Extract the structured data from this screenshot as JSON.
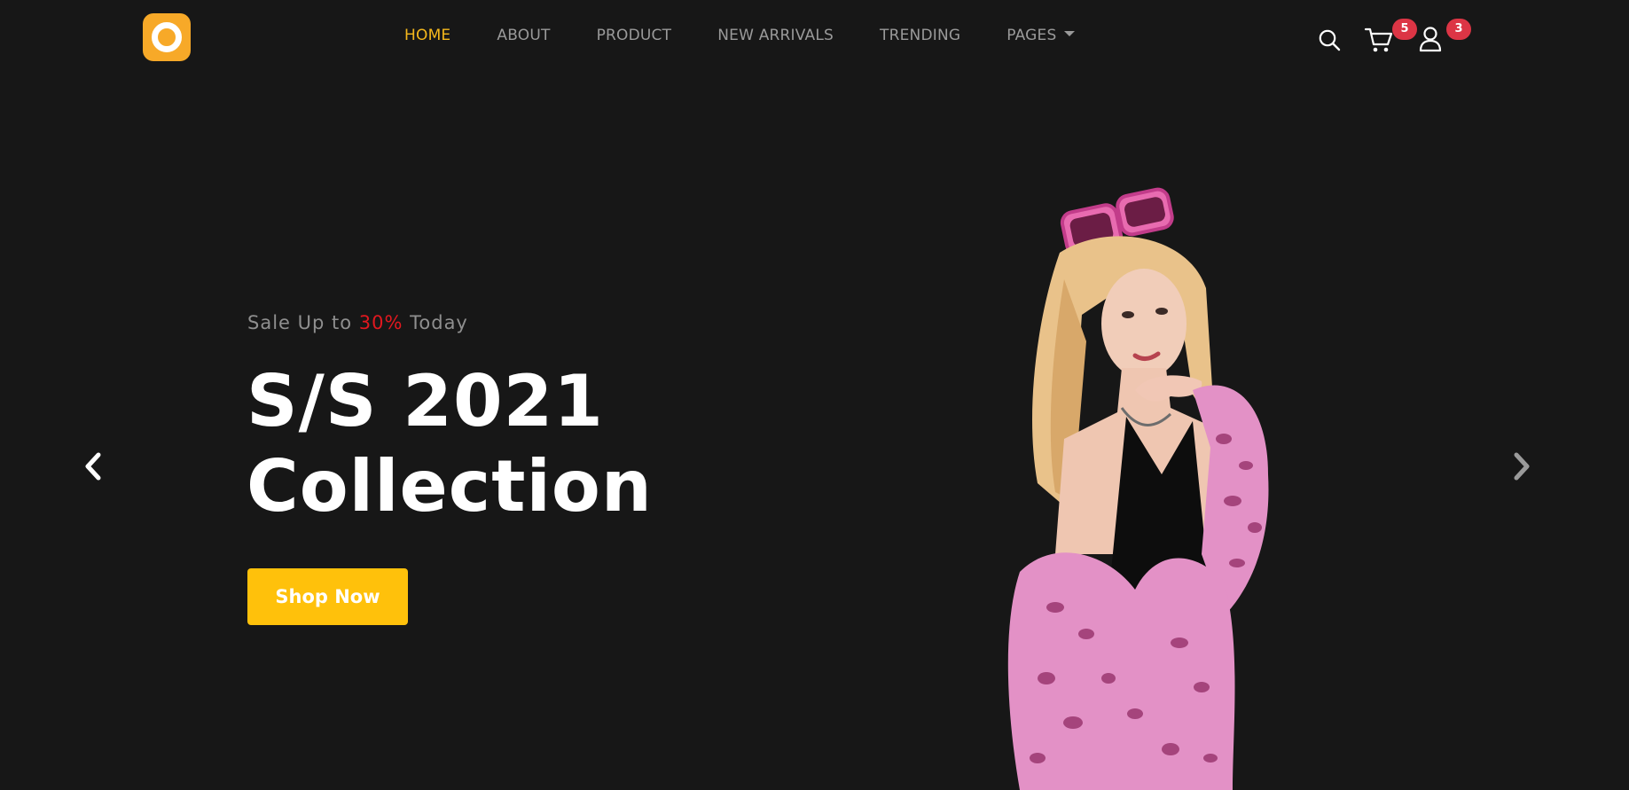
{
  "header": {
    "nav": [
      {
        "label": "HOME",
        "active": true
      },
      {
        "label": "ABOUT",
        "active": false
      },
      {
        "label": "PRODUCT",
        "active": false
      },
      {
        "label": "NEW ARRIVALS",
        "active": false
      },
      {
        "label": "TRENDING",
        "active": false
      },
      {
        "label": "PAGES",
        "active": false,
        "dropdown": true
      }
    ],
    "icons": {
      "search": "search-icon",
      "cart": "cart-icon",
      "user": "user-icon"
    },
    "cart_count": "5",
    "user_count": "3"
  },
  "hero": {
    "subtitle_prefix": "Sale Up to ",
    "subtitle_highlight": "30%",
    "subtitle_suffix": " Today",
    "title_line1": "S/S 2021",
    "title_line2": "Collection",
    "cta_label": "Shop Now"
  },
  "carousel": {
    "prev_icon": "chevron-left-icon",
    "next_icon": "chevron-right-icon"
  },
  "colors": {
    "background": "#171717",
    "accent": "#f5b81c",
    "button": "#ffc10b",
    "logo": "#f7a928",
    "badge": "#dc3545",
    "highlight": "#e0181f",
    "nav_text": "#9a9a9a"
  }
}
